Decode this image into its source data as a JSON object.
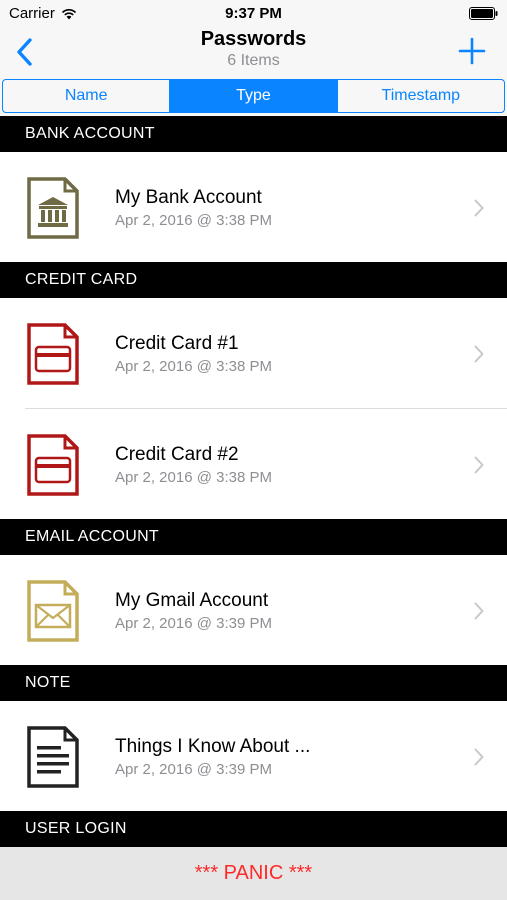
{
  "status_bar": {
    "carrier": "Carrier",
    "time": "9:37 PM"
  },
  "nav": {
    "title": "Passwords",
    "subtitle": "6 Items"
  },
  "segments": [
    {
      "label": "Name",
      "selected": false
    },
    {
      "label": "Type",
      "selected": true
    },
    {
      "label": "Timestamp",
      "selected": false
    }
  ],
  "sections": [
    {
      "header": "BANK ACCOUNT",
      "items": [
        {
          "name": "My Bank Account",
          "timestamp": "Apr 2, 2016 @ 3:38 PM",
          "icon": "bank-icon",
          "color": "#6f6a44"
        }
      ]
    },
    {
      "header": "CREDIT CARD",
      "items": [
        {
          "name": "Credit Card #1",
          "timestamp": "Apr 2, 2016 @ 3:38 PM",
          "icon": "credit-card-icon",
          "color": "#b01818"
        },
        {
          "name": "Credit Card #2",
          "timestamp": "Apr 2, 2016 @ 3:38 PM",
          "icon": "credit-card-icon",
          "color": "#b01818"
        }
      ]
    },
    {
      "header": "EMAIL ACCOUNT",
      "items": [
        {
          "name": "My Gmail Account",
          "timestamp": "Apr 2, 2016 @ 3:39 PM",
          "icon": "envelope-icon",
          "color": "#c4ad5a"
        }
      ]
    },
    {
      "header": "NOTE",
      "items": [
        {
          "name": "Things I Know About ...",
          "timestamp": "Apr 2, 2016 @ 3:39 PM",
          "icon": "note-icon",
          "color": "#222222"
        }
      ]
    },
    {
      "header": "USER LOGIN",
      "items": []
    }
  ],
  "panic_label": "*** PANIC ***",
  "colors": {
    "accent": "#0a84ff",
    "panic": "#ff2a2a",
    "section_header_bg": "#000000"
  }
}
